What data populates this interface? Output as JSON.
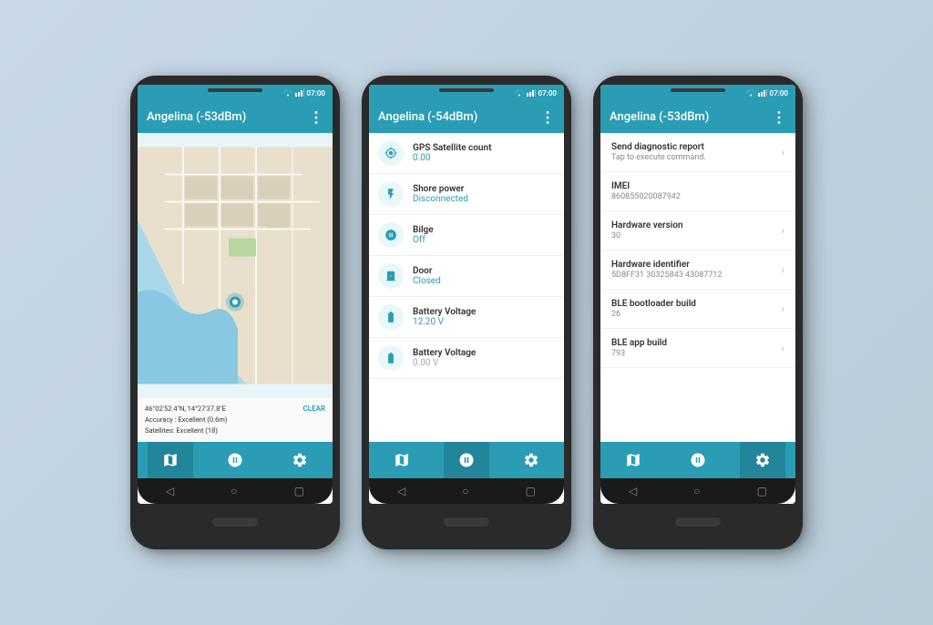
{
  "bg_color": "#c0d0dc",
  "phones": [
    {
      "id": "phone1",
      "title": "Angelina (-53dBm)",
      "type": "map",
      "status_time": "07:00",
      "map_info": {
        "coords": "46°02'52.4\"N, 14°27'37.8\"E",
        "accuracy": "Accuracy : Excellent (0.6m)",
        "satellites": "Satellites: Excellent (18)",
        "clear_label": "CLEAR"
      },
      "active_tab": 0
    },
    {
      "id": "phone2",
      "title": "Angelina (-54dBm)",
      "type": "sensors",
      "status_time": "07:00",
      "sensors": [
        {
          "label": "GPS Satellite count",
          "value": "0.00",
          "value_color": "teal"
        },
        {
          "label": "Shore power",
          "value": "Disconnected",
          "value_color": "teal"
        },
        {
          "label": "Bilge",
          "value": "Off",
          "value_color": "teal"
        },
        {
          "label": "Door",
          "value": "Closed",
          "value_color": "teal"
        },
        {
          "label": "Battery Voltage",
          "value": "12.20 V",
          "value_color": "teal"
        },
        {
          "label": "Battery Voltage",
          "value": "0.00 V",
          "value_color": "grey"
        }
      ],
      "active_tab": 1
    },
    {
      "id": "phone3",
      "title": "Angelina (-53dBm)",
      "type": "settings",
      "status_time": "07:00",
      "settings": [
        {
          "title": "Send diagnostic report",
          "subtitle": "Tap to execute command.",
          "has_chevron": true
        },
        {
          "title": "IMEI",
          "subtitle": "860855020087942",
          "has_chevron": false
        },
        {
          "title": "Hardware version",
          "subtitle": "30",
          "has_chevron": true
        },
        {
          "title": "Hardware identifier",
          "subtitle": "5D8FF31 30325843 43087712",
          "has_chevron": true
        },
        {
          "title": "BLE bootloader build",
          "subtitle": "26",
          "has_chevron": true
        },
        {
          "title": "BLE app build",
          "subtitle": "793",
          "has_chevron": true
        }
      ],
      "active_tab": 2
    }
  ],
  "nav_tabs": [
    "map",
    "sensor",
    "settings"
  ],
  "android_nav": [
    "back",
    "home",
    "recents"
  ]
}
